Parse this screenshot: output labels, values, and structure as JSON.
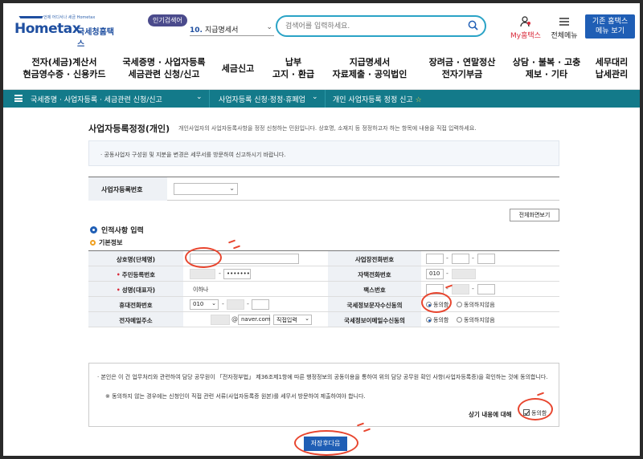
{
  "header": {
    "logo_tag": "언제 어디서나 세금 Hometax",
    "logo_text": "Hometax",
    "logo_kr": "국세청홈택스",
    "popular_badge": "인기검색어",
    "popular_num": "10.",
    "popular_value": "지급명세서",
    "search_placeholder": "검색어를 입력하세요.",
    "myhome": "My홈택스",
    "allmenu": "전체메뉴",
    "std_btn_1": "기존 홈택스",
    "std_btn_2": "메뉴 보기"
  },
  "nav": [
    {
      "l1": "전자(세금)계산서",
      "l2": "현금영수증 · 신용카드"
    },
    {
      "l1": "국세증명 · 사업자등록",
      "l2": "세금관련 신청/신고"
    },
    {
      "l1": "세금신고",
      "l2": ""
    },
    {
      "l1": "납부",
      "l2": "고지 · 환급"
    },
    {
      "l1": "지급명세서",
      "l2": "자료제출 · 공익법인"
    },
    {
      "l1": "장려금 · 연말정산",
      "l2": "전자기부금"
    },
    {
      "l1": "상담 · 불복 · 고충",
      "l2": "제보 · 기타"
    },
    {
      "l1": "세무대리",
      "l2": "납세관리"
    }
  ],
  "breadcrumb": {
    "seg1": "국세증명 · 사업자등록 · 세금관련 신청/신고",
    "seg2": "사업자등록 신청·정정·휴폐업",
    "seg3": "개인 사업자등록 정정 신고"
  },
  "page": {
    "title": "사업자등록정정(개인)",
    "desc": "개인사업자의 사업자등록사항을 정정 신청하는 민원입니다. 상호명, 소재지 등 정정하고자 하는 항목에 내용을 직접 입력하세요.",
    "notice": "· 공동사업자 구성원 및 지분을 변경은 세무서를 방문하여 신고하시기 바랍니다.",
    "bizno_label": "사업자등록번호",
    "fullview_btn": "전체화면보기",
    "section_title": "인적사항 입력",
    "sub_title": "기본정보"
  },
  "form": {
    "trade_name_label": "상호명(단체명)",
    "rrn_label": "주민등록번호",
    "rrn_back": "•••••••",
    "name_label": "성명(대표자)",
    "name_value": "이하나",
    "mobile_label": "휴대전화번호",
    "mobile_prefix": "010",
    "email_label": "전자메일주소",
    "email_domain": "naver.com",
    "email_select": "직접입력",
    "biz_phone_label": "사업장전화번호",
    "home_phone_label": "자택전화번호",
    "home_phone_prefix": "010",
    "fax_label": "팩스번호",
    "sms_label": "국세정보문자수신동의",
    "email_agree_label": "국세정보이메일수신동의",
    "agree": "동의함",
    "disagree": "동의하지않음"
  },
  "agreement": {
    "text1": "· 본인은 이 건 업무처리와 관련하여 담당 공무원이 「전자정부법」 제36조제1항에 따른 행정정보의 공동이용을 통하여 위의 담당 공무원 확인 사항(사업자등록증)을 확인하는 것에 동의합니다.",
    "text2": "※ 동의하지 않는 경우에는 신청인이 직접 관련 서류(사업자등록증 원본)를 세무서 방문하여 제출하여야 합니다.",
    "label": "상기 내용에 대해",
    "check": "동의함"
  },
  "save_btn": "저장후다음",
  "colors": {
    "accent": "#1f5eb5",
    "breadcrumb_bg": "#137a8a",
    "annotation": "#e8462f",
    "required": "#d92a3a"
  }
}
